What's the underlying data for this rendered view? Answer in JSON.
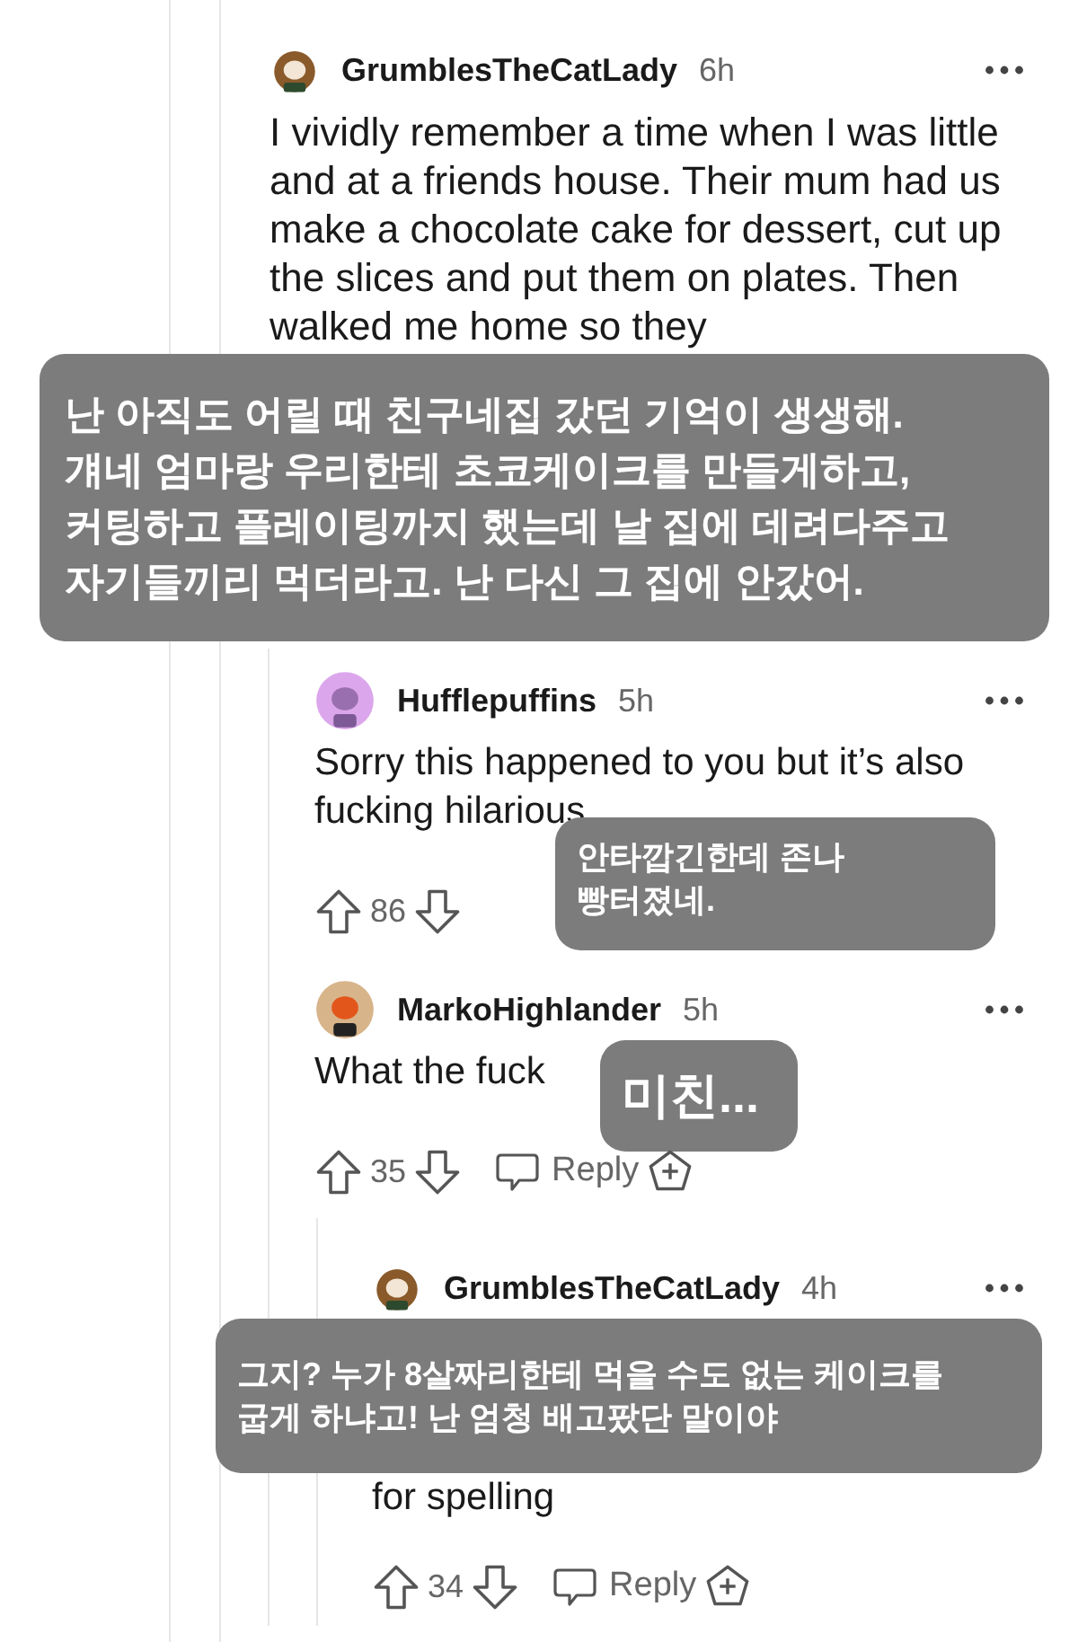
{
  "comments": [
    {
      "author": "GrumblesTheCatLady",
      "time": "6h",
      "body": "I vividly remember a time when I was little and at a friends house. Their mum had us make a chocolate cake for dessert, cut up the slices and put them on plates. Then walked me home so they",
      "caption_after_body": "난 아직도 어릴 때 친구네집 갔던 기억이 생생해.\n걔네 엄마랑 우리한테 초코케이크를 만들게하고,\n커팅하고 플레이팅까지 했는데 날 집에 데려다주고\n자기들끼리 먹더라고. 난 다신 그 집에 안갔어.",
      "children": [
        {
          "author": "Hufflepuffins",
          "time": "5h",
          "body": "Sorry this happened to you but it’s also fucking hilarious",
          "votes": "86",
          "caption_over_actions": "안타깝긴한데 존나\n빵터졌네."
        },
        {
          "author": "MarkoHighlander",
          "time": "5h",
          "body": "What the fuck",
          "votes": "35",
          "reply": "Reply",
          "caption_beside_body": "미친...",
          "children": [
            {
              "author": "GrumblesTheCatLady",
              "time": "4h",
              "body": "for spelling",
              "votes": "34",
              "reply": "Reply",
              "caption_over_body": "그지? 누가 8살짜리한테 먹을 수도 없는 케이크를\n굽게 하냐고! 난 엄청 배고팠단 말이야"
            }
          ]
        }
      ]
    }
  ]
}
